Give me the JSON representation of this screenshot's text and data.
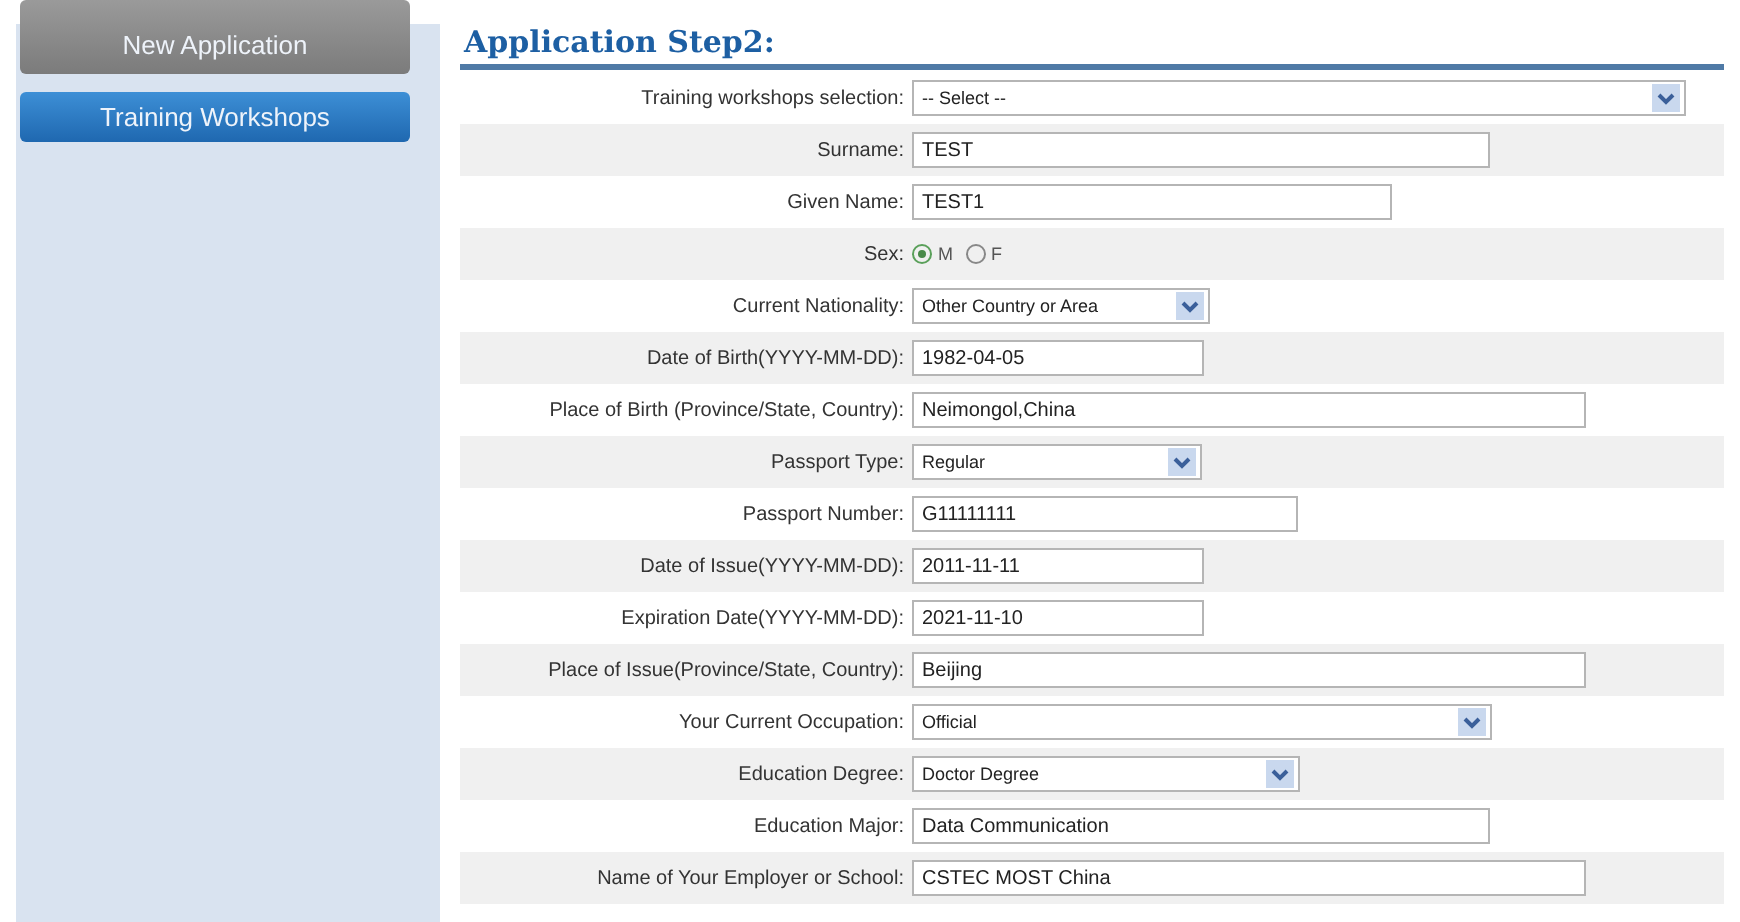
{
  "sidebar": {
    "items": [
      {
        "label": "New Application",
        "selected": false
      },
      {
        "label": "Training Workshops",
        "selected": true
      }
    ]
  },
  "form": {
    "title": "Application Step2:",
    "fields": [
      {
        "label": "Training workshops selection:",
        "kind": "select",
        "value": "-- Select --"
      },
      {
        "label": "Surname:",
        "kind": "text",
        "value": "TEST"
      },
      {
        "label": "Given Name:",
        "kind": "text",
        "value": "TEST1"
      },
      {
        "label": "Sex:",
        "kind": "radio",
        "options": [
          {
            "label": "M",
            "selected": true
          },
          {
            "label": "F",
            "selected": false
          }
        ]
      },
      {
        "label": "Current Nationality:",
        "kind": "select",
        "value": "Other Country or Area"
      },
      {
        "label": "Date of Birth(YYYY-MM-DD):",
        "kind": "text",
        "value": "1982-04-05"
      },
      {
        "label": "Place of Birth (Province/State, Country):",
        "kind": "text",
        "value": "Neimongol,China"
      },
      {
        "label": "Passport Type:",
        "kind": "select",
        "value": "Regular"
      },
      {
        "label": "Passport Number:",
        "kind": "text",
        "value": "G11111111"
      },
      {
        "label": "Date of Issue(YYYY-MM-DD):",
        "kind": "text",
        "value": "2011-11-11"
      },
      {
        "label": "Expiration Date(YYYY-MM-DD):",
        "kind": "text",
        "value": "2021-11-10"
      },
      {
        "label": "Place of Issue(Province/State, Country):",
        "kind": "text",
        "value": "Beijing"
      },
      {
        "label": "Your Current Occupation:",
        "kind": "select",
        "value": "Official"
      },
      {
        "label": "Education Degree:",
        "kind": "select",
        "value": "Doctor Degree"
      },
      {
        "label": "Education Major:",
        "kind": "text",
        "value": "Data Communication"
      },
      {
        "label": "Name of Your Employer or School:",
        "kind": "text",
        "value": "CSTEC MOST China"
      }
    ]
  }
}
